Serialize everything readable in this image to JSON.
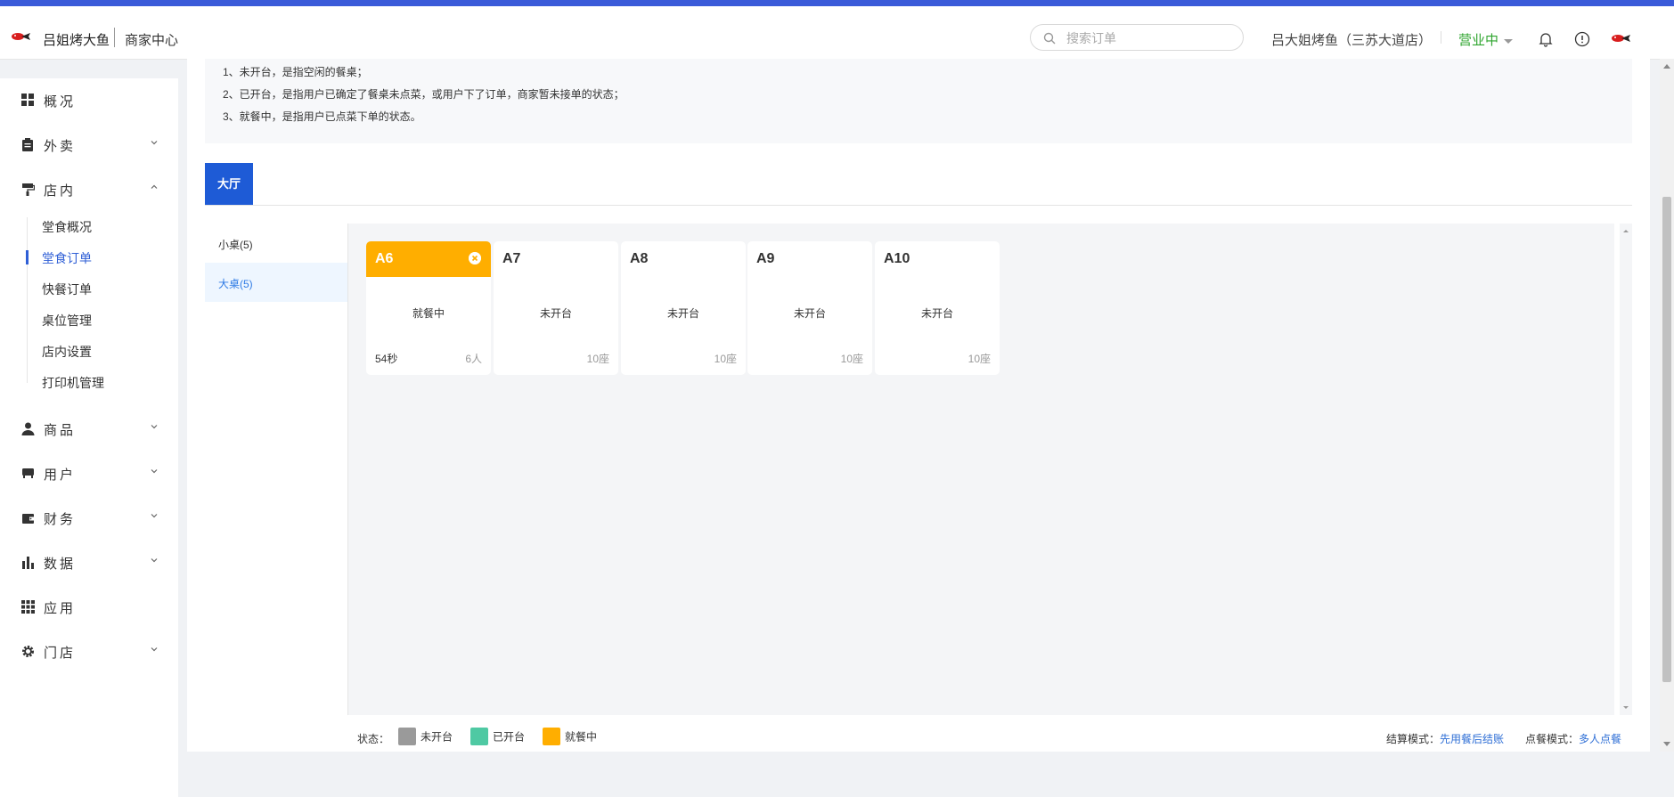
{
  "header": {
    "brand": "吕姐烤大鱼",
    "merchant_center": "商家中心",
    "search_placeholder": "搜索订单",
    "store_name": "吕大姐烤鱼（三苏大道店）",
    "business_status": "营业中"
  },
  "sidebar": {
    "overview": "概况",
    "takeout": "外卖",
    "dine_in": "店内",
    "sub_items": [
      "堂食概况",
      "堂食订单",
      "快餐订单",
      "桌位管理",
      "店内设置",
      "打印机管理"
    ],
    "goods": "商品",
    "users": "用户",
    "finance": "财务",
    "data": "数据",
    "apps": "应用",
    "store": "门店"
  },
  "notice": {
    "lines": [
      "1、未开台，是指空闲的餐桌；",
      "2、已开台，是指用户已确定了餐桌未点菜，或用户下了订单，商家暂未接单的状态；",
      "3、就餐中，是指用户已点菜下单的状态。"
    ]
  },
  "hall_tab": "大厅",
  "categories": [
    {
      "label": "小桌(5)",
      "active": false
    },
    {
      "label": "大桌(5)",
      "active": true
    }
  ],
  "tables": [
    {
      "name": "A6",
      "status": "就餐中",
      "left": "54秒",
      "right": "6人",
      "busy": true
    },
    {
      "name": "A7",
      "status": "未开台",
      "left": "",
      "right": "10座",
      "busy": false
    },
    {
      "name": "A8",
      "status": "未开台",
      "left": "",
      "right": "10座",
      "busy": false
    },
    {
      "name": "A9",
      "status": "未开台",
      "left": "",
      "right": "10座",
      "busy": false
    },
    {
      "name": "A10",
      "status": "未开台",
      "left": "",
      "right": "10座",
      "busy": false
    }
  ],
  "legend": {
    "title": "状态：",
    "items": [
      {
        "label": "未开台",
        "color": "#9a9a9a"
      },
      {
        "label": "已开台",
        "color": "#4fc9a3"
      },
      {
        "label": "就餐中",
        "color": "#ffae00"
      }
    ]
  },
  "modes": {
    "settle_label": "结算模式：",
    "settle_value": "先用餐后结账",
    "order_label": "点餐模式：",
    "order_value": "多人点餐"
  },
  "colors": {
    "accent": "#1e5bd6",
    "busy": "#ffae00",
    "open_status": "#2fa52f"
  }
}
